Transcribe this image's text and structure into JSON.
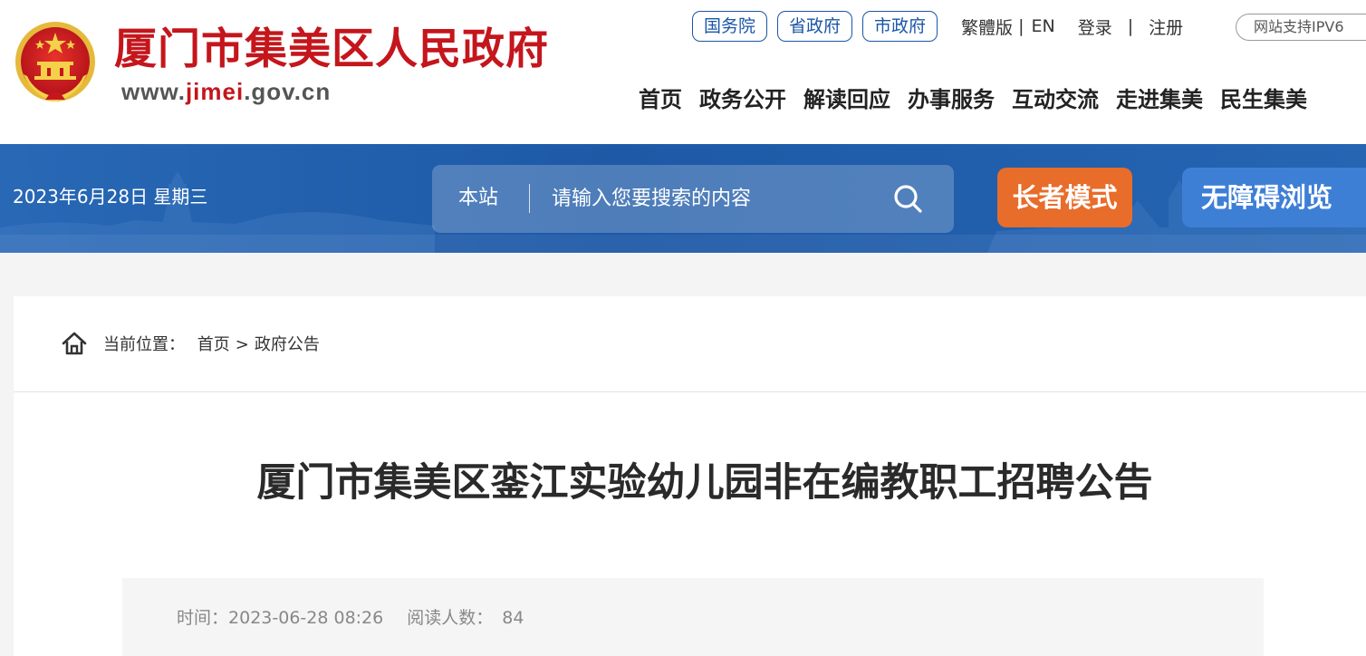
{
  "header": {
    "site_title": "厦门市集美区人民政府",
    "url_prefix": "www.",
    "url_highlight": "jimei",
    "url_suffix": ".gov.cn",
    "top_links": [
      "国务院",
      "省政府",
      "市政府"
    ],
    "traditional": "繁體版",
    "sep1": "|",
    "english": "EN",
    "login": "登录",
    "sep2": "|",
    "register": "注册",
    "ipv6": "网站支持IPV6",
    "nav": [
      "首页",
      "政务公开",
      "解读回应",
      "办事服务",
      "互动交流",
      "走进集美",
      "民生集美"
    ]
  },
  "banner": {
    "date": "2023年6月28日 星期三",
    "scope": "本站",
    "search_placeholder": "请输入您要搜索的内容",
    "elder_mode": "长者模式",
    "accessible": "无障碍浏览"
  },
  "breadcrumb": {
    "label": "当前位置：",
    "items": [
      "首页",
      "政府公告"
    ],
    "separator": ">"
  },
  "article": {
    "title": "厦门市集美区銮江实验幼儿园非在编教职工招聘公告",
    "time_label": "时间：",
    "time_value": "2023-06-28 08:26",
    "views_label": "阅读人数：",
    "views_value": "84"
  },
  "colors": {
    "brand_red": "#c4161c",
    "banner_blue": "#1d59a6",
    "pill_blue": "#1a56a6",
    "elder_orange": "#e86c2a",
    "access_blue": "#3e7fd6"
  },
  "icons": [
    "national-emblem-icon",
    "search-icon",
    "home-icon"
  ]
}
